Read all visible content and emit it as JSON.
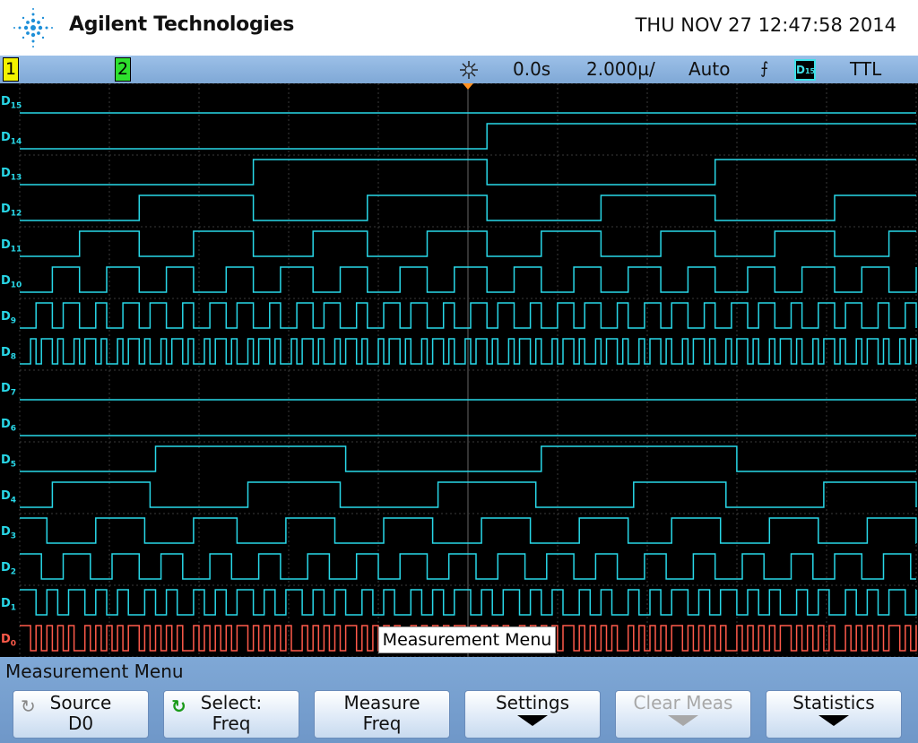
{
  "header": {
    "brand": "Agilent Technologies",
    "datetime": "THU NOV 27 12:47:58 2014"
  },
  "status": {
    "ch1": "1",
    "ch2": "2",
    "delay": "0.0s",
    "timebase": "2.000µ/",
    "trigger_mode": "Auto",
    "trigger_source": "D15",
    "threshold": "TTL"
  },
  "channels": [
    "D15",
    "D14",
    "D13",
    "D12",
    "D11",
    "D10",
    "D9",
    "D8",
    "D7",
    "D6",
    "D5",
    "D4",
    "D3",
    "D2",
    "D1",
    "D0"
  ],
  "popup": "Measurement Menu",
  "menu": {
    "title": "Measurement Menu",
    "softkeys": [
      {
        "line1": "Source",
        "line2": "D0"
      },
      {
        "line1": "Select:",
        "line2": "Freq"
      },
      {
        "line1": "Measure",
        "line2": "Freq"
      },
      {
        "line1": "Settings",
        "line2": ""
      },
      {
        "line1": "Clear Meas",
        "line2": ""
      },
      {
        "line1": "Statistics",
        "line2": ""
      }
    ]
  },
  "colors": {
    "trace": "#28d8e8",
    "d0_trace": "#ff5a4a",
    "grid": "#3a3a3a",
    "menu_bg": "#7fa8d6"
  }
}
